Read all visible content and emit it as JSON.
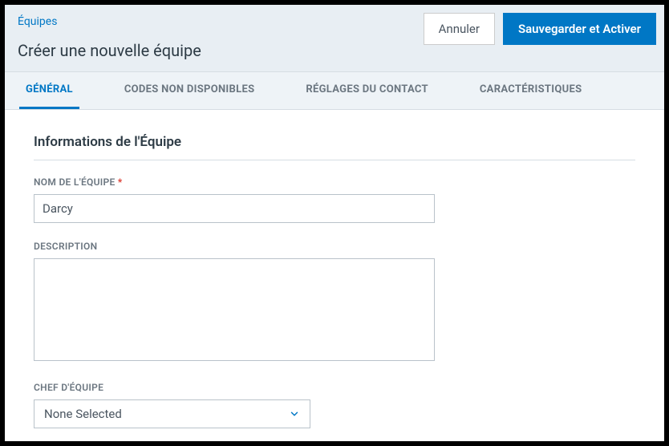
{
  "breadcrumb": "Équipes",
  "pageTitle": "Créer une nouvelle équipe",
  "actions": {
    "cancel": "Annuler",
    "save": "Sauvegarder et Activer"
  },
  "tabs": {
    "general": "GÉNÉRAL",
    "codes": "CODES NON DISPONIBLES",
    "contact": "RÉGLAGES DU CONTACT",
    "characteristics": "CARACTÉRISTIQUES"
  },
  "section": {
    "title": "Informations de l'Équipe"
  },
  "fields": {
    "teamName": {
      "label": "NOM DE L'ÉQUIPE",
      "value": "Darcy"
    },
    "description": {
      "label": "DESCRIPTION",
      "value": ""
    },
    "teamLead": {
      "label": "CHEF D'ÉQUIPE",
      "selected": "None Selected"
    }
  }
}
